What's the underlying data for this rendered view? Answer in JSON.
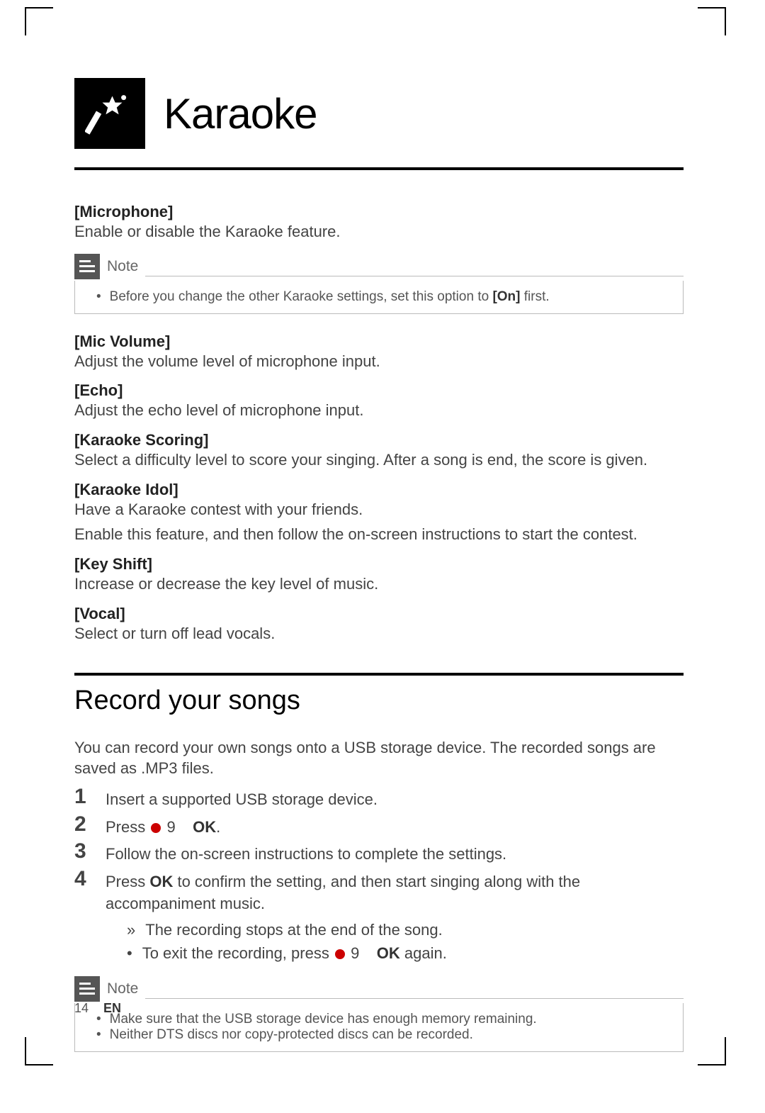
{
  "chapter": {
    "title": "Karaoke"
  },
  "settings": {
    "microphone": {
      "title": "[Microphone]",
      "desc": "Enable or disable the Karaoke feature."
    },
    "micVolume": {
      "title": "[Mic Volume]",
      "desc": "Adjust the volume level of microphone input."
    },
    "echo": {
      "title": "[Echo]",
      "desc": "Adjust the echo level of microphone input."
    },
    "karaokeScoring": {
      "title": "[Karaoke Scoring]",
      "desc": "Select a difficulty level to score your singing. After a song is end, the score is given."
    },
    "karaokeIdol": {
      "title": "[Karaoke Idol]",
      "desc1": "Have a Karaoke contest with your friends.",
      "desc2": "Enable this feature, and then follow the on-screen instructions to start the contest."
    },
    "keyShift": {
      "title": "[Key Shift]",
      "desc": "Increase or decrease the key level of music."
    },
    "vocal": {
      "title": "[Vocal]",
      "desc": "Select or turn off lead vocals."
    }
  },
  "note1": {
    "label": "Note",
    "item_prefix": "Before you change the other Karaoke settings, set this option to ",
    "item_bold": "[On]",
    "item_suffix": " first."
  },
  "section": {
    "title": "Record your songs",
    "intro": "You can record your own songs onto a USB storage device. The recorded songs are saved as .MP3 files.",
    "steps": {
      "s1": {
        "num": "1",
        "text": "Insert a supported USB storage device."
      },
      "s2": {
        "num": "2",
        "prefix": "Press ",
        "mid": " 9",
        "ok": "OK",
        "suffix": "."
      },
      "s3": {
        "num": "3",
        "text": "Follow the on-screen instructions to complete the settings."
      },
      "s4": {
        "num": "4",
        "prefix": "Press ",
        "ok": "OK",
        "suffix": " to confirm the setting, and then start singing along with the accompaniment music.",
        "sub1": "The recording stops at the end of the song.",
        "sub2_prefix": "To exit the recording, press ",
        "sub2_mid": " 9",
        "sub2_ok": "OK",
        "sub2_suffix": " again."
      }
    }
  },
  "note2": {
    "label": "Note",
    "item1": "Make sure that the USB storage device has enough memory remaining.",
    "item2": "Neither DTS discs nor copy-protected discs can be recorded."
  },
  "footer": {
    "page": "14",
    "lang": "EN"
  }
}
